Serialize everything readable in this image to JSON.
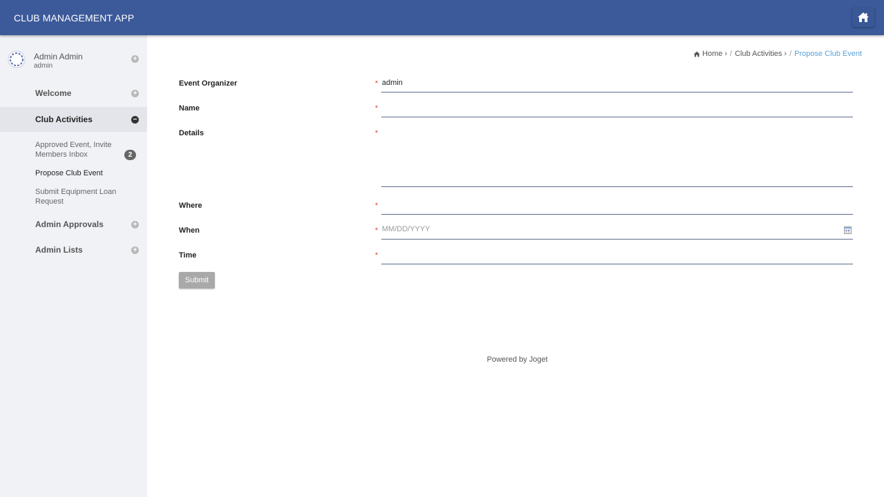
{
  "header": {
    "app_title": "CLUB MANAGEMENT APP",
    "home_icon": "home-icon"
  },
  "user": {
    "name": "Admin Admin",
    "id": "admin"
  },
  "sidebar": {
    "items": [
      {
        "label": "Welcome"
      },
      {
        "label": "Club Activities",
        "subitems": [
          {
            "label": "Approved Event, Invite Members Inbox",
            "badge": "2"
          },
          {
            "label": "Propose Club Event"
          },
          {
            "label": "Submit Equipment Loan Request"
          }
        ]
      },
      {
        "label": "Admin Approvals"
      },
      {
        "label": "Admin Lists"
      }
    ]
  },
  "breadcrumb": {
    "home": "Home",
    "section": "Club Activities",
    "current": "Propose Club Event"
  },
  "form": {
    "required_mark": "*",
    "fields": [
      {
        "label": "Event Organizer",
        "value": "admin"
      },
      {
        "label": "Name",
        "value": ""
      },
      {
        "label": "Details",
        "value": ""
      },
      {
        "label": "Where",
        "value": ""
      },
      {
        "label": "When",
        "value": "",
        "placeholder": "MM/DD/YYYY"
      },
      {
        "label": "Time",
        "value": ""
      }
    ],
    "submit_label": "Submit"
  },
  "footer": {
    "text": "Powered by Joget"
  },
  "colors": {
    "header": "#3c5a9a",
    "sidebar": "#f1f2f6",
    "breadcrumb_active": "#5aa3d8",
    "required": "#e04040"
  }
}
